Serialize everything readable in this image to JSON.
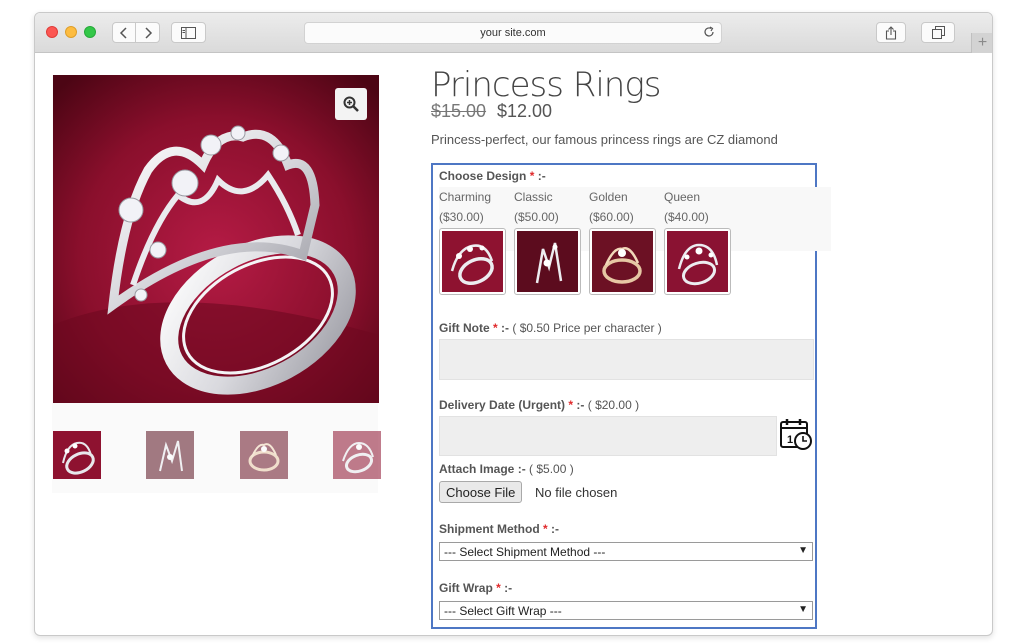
{
  "browser": {
    "url": "your site.com"
  },
  "product": {
    "title": "Princess Rings",
    "old_price": "$15.00",
    "price": "$12.00",
    "description": "Princess-perfect, our famous princess rings are CZ diamond"
  },
  "form": {
    "design": {
      "label": "Choose Design",
      "required": "*",
      "suffix": ":-",
      "options": [
        {
          "name": "Charming",
          "price": "($30.00)"
        },
        {
          "name": "Classic",
          "price": "($50.00)"
        },
        {
          "name": "Golden",
          "price": "($60.00)"
        },
        {
          "name": "Queen",
          "price": "($40.00)"
        }
      ]
    },
    "gift_note": {
      "label": "Gift Note",
      "required": "*",
      "suffix": ":-",
      "note": "( $0.50 Price per character )"
    },
    "delivery_date": {
      "label": "Delivery Date (Urgent)",
      "required": "*",
      "suffix": ":-",
      "note": "( $20.00 )"
    },
    "attach_image": {
      "label": "Attach Image",
      "suffix": ":-",
      "note": "( $5.00 )",
      "button": "Choose File",
      "status": "No file chosen"
    },
    "shipment": {
      "label": "Shipment Method",
      "required": "*",
      "suffix": ":-",
      "selected": "--- Select Shipment Method ---"
    },
    "gift_wrap": {
      "label": "Gift Wrap",
      "required": "*",
      "suffix": ":-",
      "selected": "--- Select Gift Wrap ---"
    }
  },
  "colors": {
    "accent_border": "#4e77c4",
    "required": "#e0292b",
    "ring_bg": "#8e1230"
  }
}
